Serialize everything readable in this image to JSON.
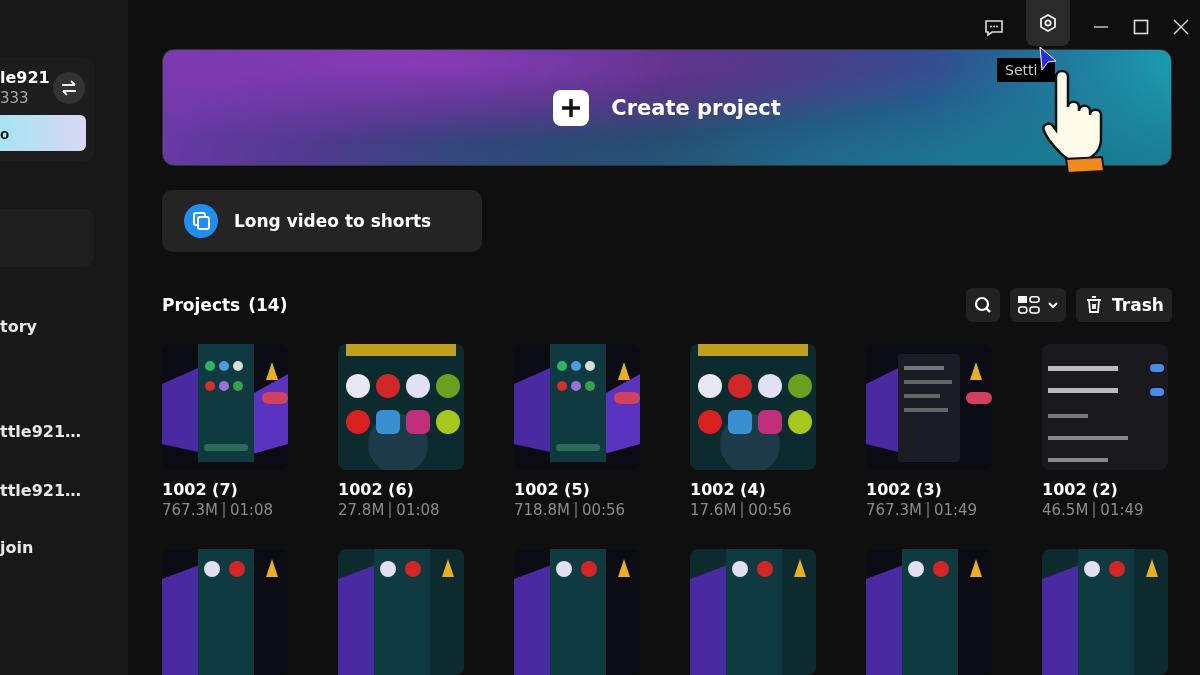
{
  "sidebar": {
    "account": {
      "name": "le921",
      "id": "333"
    },
    "pro_button": "o",
    "items": [
      {
        "label": "tory"
      },
      {
        "label": "ttle921…"
      },
      {
        "label": "ttle921…"
      },
      {
        "label": "join"
      }
    ]
  },
  "title_bar": {
    "tooltip": "Setti"
  },
  "banner": {
    "label": "Create project"
  },
  "shortcut": {
    "label": "Long video to shorts"
  },
  "projects": {
    "title": "Projects",
    "count": "(14)",
    "trash": "Trash",
    "items": [
      {
        "name": "1002 (7)",
        "size": "767.3M",
        "duration": "01:08"
      },
      {
        "name": "1002 (6)",
        "size": "27.8M",
        "duration": "01:08"
      },
      {
        "name": "1002 (5)",
        "size": "718.8M",
        "duration": "00:56"
      },
      {
        "name": "1002 (4)",
        "size": "17.6M",
        "duration": "00:56"
      },
      {
        "name": "1002 (3)",
        "size": "767.3M",
        "duration": "01:49"
      },
      {
        "name": "1002 (2)",
        "size": "46.5M",
        "duration": "01:49"
      }
    ]
  }
}
